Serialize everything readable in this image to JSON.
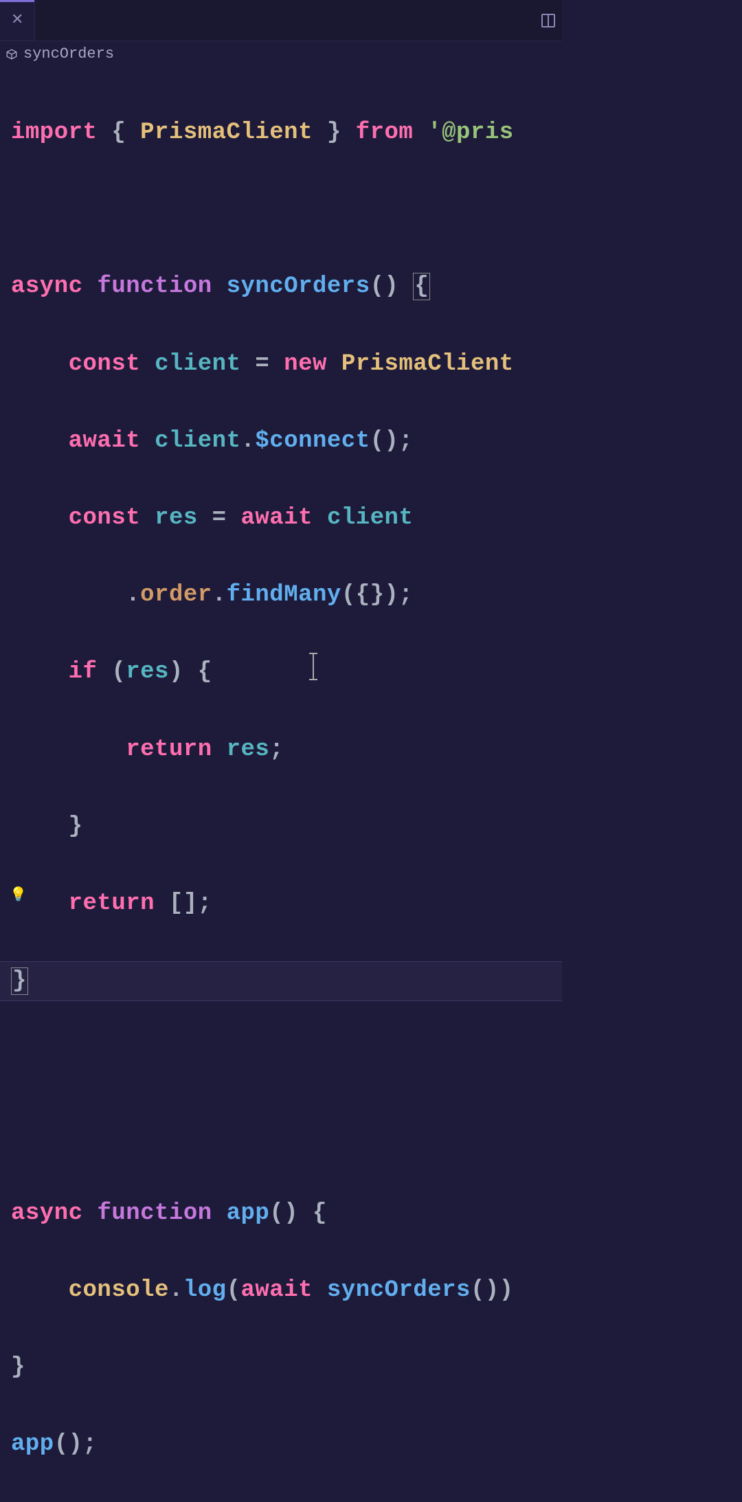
{
  "breadcrumb": {
    "symbol": "syncOrders"
  },
  "code": {
    "l1": {
      "import": "import",
      "lb": " { ",
      "cls": "PrismaClient",
      "rb": " } ",
      "from": "from",
      "sp": " ",
      "q": "'",
      "str": "@pris"
    },
    "l3": {
      "async": "async",
      "function": "function",
      "name": "syncOrders",
      "parens": "()",
      "brace": "{"
    },
    "l4": {
      "indent": "    ",
      "const": "const",
      "sp": " ",
      "client": "client",
      "eq": " = ",
      "new": "new",
      "sp2": " ",
      "cls": "PrismaClient"
    },
    "l5": {
      "indent": "    ",
      "await": "await",
      "sp": " ",
      "client": "client",
      "dot": ".",
      "method": "$connect",
      "call": "();"
    },
    "l6": {
      "indent": "    ",
      "const": "const",
      "sp": " ",
      "res": "res",
      "eq": " = ",
      "await": "await",
      "sp2": " ",
      "client": "client"
    },
    "l7": {
      "indent": "        ",
      "dot1": ".",
      "order": "order",
      "dot2": ".",
      "method": "findMany",
      "args": "({});"
    },
    "l8": {
      "indent": "    ",
      "if": "if",
      "sp": " (",
      "res": "res",
      "rb": ") {"
    },
    "l9": {
      "indent": "        ",
      "return": "return",
      "sp": " ",
      "res": "res",
      "semi": ";"
    },
    "l10": {
      "indent": "    ",
      "brace": "}"
    },
    "l11": {
      "indent": "    ",
      "return": "return",
      "sp": " ",
      "arr": "[];"
    },
    "l12": {
      "brace": "}"
    },
    "l14": {
      "async": "async",
      "function": "function",
      "name": "app",
      "parens": "()",
      "brace": " {"
    },
    "l15": {
      "indent": "    ",
      "console": "console",
      "dot": ".",
      "log": "log",
      "lp": "(",
      "await": "await",
      "sp": " ",
      "call": "syncOrders",
      "rp": "())"
    },
    "l16": {
      "brace": "}"
    },
    "l17": {
      "app": "app",
      "call": "();"
    }
  }
}
